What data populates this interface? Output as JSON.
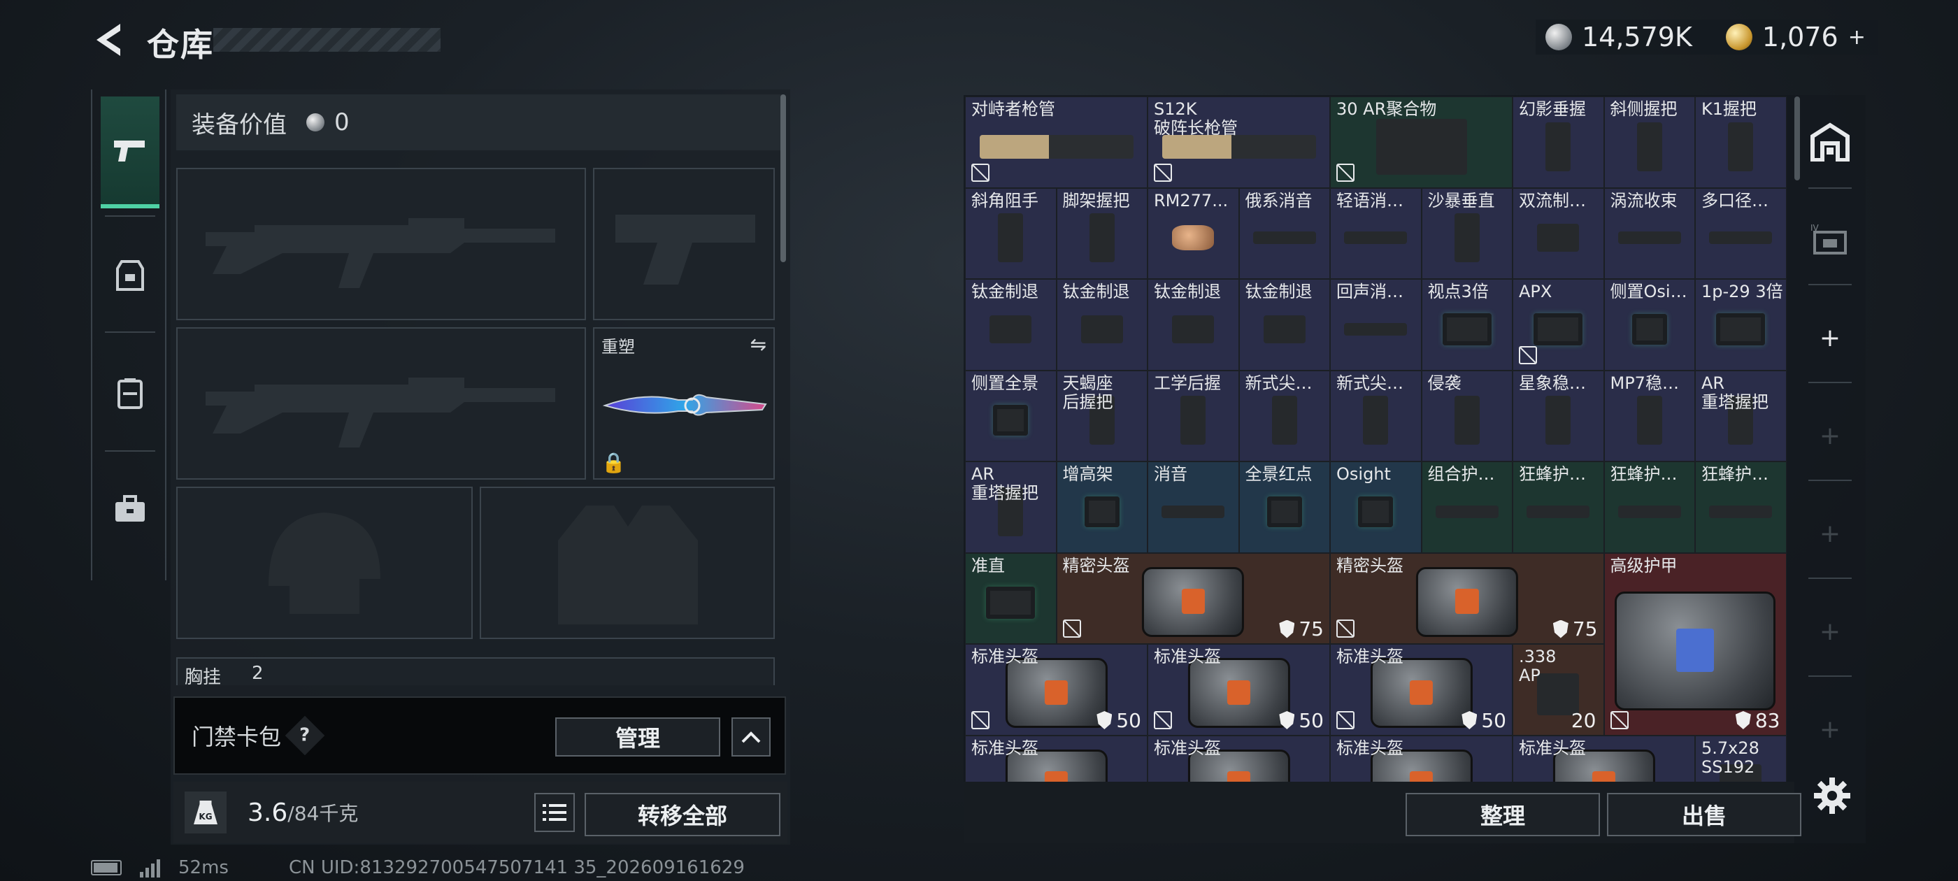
{
  "header": {
    "title": "仓库",
    "silver_amount": "14,579K",
    "gold_amount": "1,076",
    "gold_add": "+"
  },
  "left": {
    "value_label": "装备价值",
    "value_amount": "0",
    "slot_reskin_label": "重塑",
    "chest_label": "胸挂",
    "chest_count": "2",
    "access_card_label": "门禁卡包",
    "access_card_help": "?",
    "manage_button": "管理",
    "weight_value": "3.6",
    "weight_total": "/84千克",
    "kg_icon_label": "KG",
    "transfer_all_button": "转移全部"
  },
  "status": {
    "ping": "52ms",
    "uid": "CN UID:813292700547507141 35_202609161629"
  },
  "grid": {
    "items": [
      {
        "name": "对峙者枪管",
        "nobadge": true
      },
      {
        "name": "S12K\n破阵长枪管",
        "nobadge": true
      },
      {
        "name": "30 AR聚合物",
        "nobadge": true
      },
      {
        "name": "幻影垂握"
      },
      {
        "name": "斜侧握把"
      },
      {
        "name": "K1握把"
      },
      {
        "name": "斜角阻手"
      },
      {
        "name": "脚架握把"
      },
      {
        "name": "RM277..."
      },
      {
        "name": "俄系消音"
      },
      {
        "name": "轻语消音器"
      },
      {
        "name": "沙暴垂直"
      },
      {
        "name": "双流制退器"
      },
      {
        "name": "涡流收束"
      },
      {
        "name": "多口径消..."
      },
      {
        "name": "钛金制退"
      },
      {
        "name": "钛金制退"
      },
      {
        "name": "钛金制退"
      },
      {
        "name": "钛金制退"
      },
      {
        "name": "回声消音器"
      },
      {
        "name": "视点3倍"
      },
      {
        "name": "APX",
        "nobadge": true
      },
      {
        "name": "侧置Osig..."
      },
      {
        "name": "1p-29 3倍"
      },
      {
        "name": "侧置全景"
      },
      {
        "name": "天蝎座\n后握把"
      },
      {
        "name": "工学后握"
      },
      {
        "name": "新式尖兵..."
      },
      {
        "name": "新式尖兵..."
      },
      {
        "name": "侵袭"
      },
      {
        "name": "星象稳固..."
      },
      {
        "name": "MP7稳固..."
      },
      {
        "name": "AR\n重塔握把"
      },
      {
        "name": "AR\n重塔握把"
      },
      {
        "name": "增高架"
      },
      {
        "name": "消音"
      },
      {
        "name": "全景红点"
      },
      {
        "name": "Osight"
      },
      {
        "name": "组合护木片"
      },
      {
        "name": "狂蜂护木片"
      },
      {
        "name": "狂蜂护木片"
      },
      {
        "name": "狂蜂护木片"
      },
      {
        "name": "准直"
      },
      {
        "name": "精密头盔",
        "nobadge": true,
        "durability": "75"
      },
      {
        "name": "精密头盔",
        "nobadge": true,
        "durability": "75"
      },
      {
        "name": "高级护甲",
        "nobadge": true,
        "durability": "83"
      },
      {
        "name": "标准头盔",
        "nobadge": true,
        "durability": "50"
      },
      {
        "name": "标准头盔",
        "nobadge": true,
        "durability": "50"
      },
      {
        "name": "标准头盔",
        "nobadge": true,
        "durability": "50"
      },
      {
        "name": ".338\nAP",
        "count": "20"
      },
      {
        "name": "标准头盔"
      },
      {
        "name": "标准头盔"
      },
      {
        "name": "标准头盔"
      },
      {
        "name": "标准头盔"
      },
      {
        "name": "5.7x28\nSS192"
      }
    ]
  },
  "bottom": {
    "sort_button": "整理",
    "sell_button": "出售"
  },
  "colors": {
    "accent_green": "#4fd1a5",
    "item_purple": "#2a2d49",
    "item_blue": "#22374a",
    "item_green": "#1d3630",
    "item_brown": "#3e2c26",
    "item_red": "#4a2226"
  }
}
